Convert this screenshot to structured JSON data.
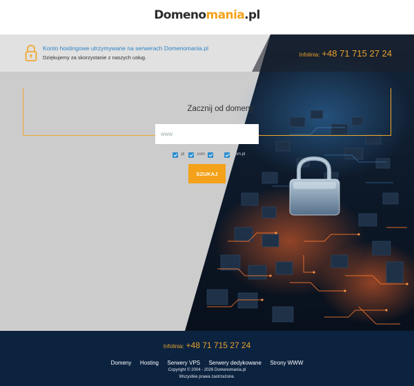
{
  "logo": {
    "part1": "Domeno",
    "part2": "mania",
    "part3": ".pl"
  },
  "notice": {
    "icon": "padlock-icon",
    "title": "Konto hostingowe utrzymywane na serwerach Domenomania.pl",
    "subtitle": "Dziękujemy za skorzystanie z naszych usług."
  },
  "infoline": {
    "label": "Infolinia:",
    "number": "+48 71 715 27 24"
  },
  "search": {
    "title": "Zacznij od domeny",
    "placeholder": "www",
    "tlds": [
      {
        "label": ".pl",
        "checked": true
      },
      {
        "label": ".com",
        "checked": true
      },
      {
        "label": ".eu",
        "checked": true
      },
      {
        "label": ".com.pl",
        "checked": true
      }
    ],
    "button": "SZUKAJ"
  },
  "footer": {
    "infoline_label": "Infolinia:",
    "infoline_number": "+48 71 715 27 24",
    "nav": [
      "Domeny",
      "Hosting",
      "Serwery VPS",
      "Serwery dedykowane",
      "Strony WWW"
    ],
    "copyright": "Copyright © 2004 - 2026 Domenomania.pl",
    "rights": "Wszystkie prawa zastrzeżone."
  },
  "colors": {
    "accent": "#f3a21a",
    "link": "#2e82c2",
    "footer_bg": "#0c2340",
    "checkbox": "#2d8ecf"
  }
}
